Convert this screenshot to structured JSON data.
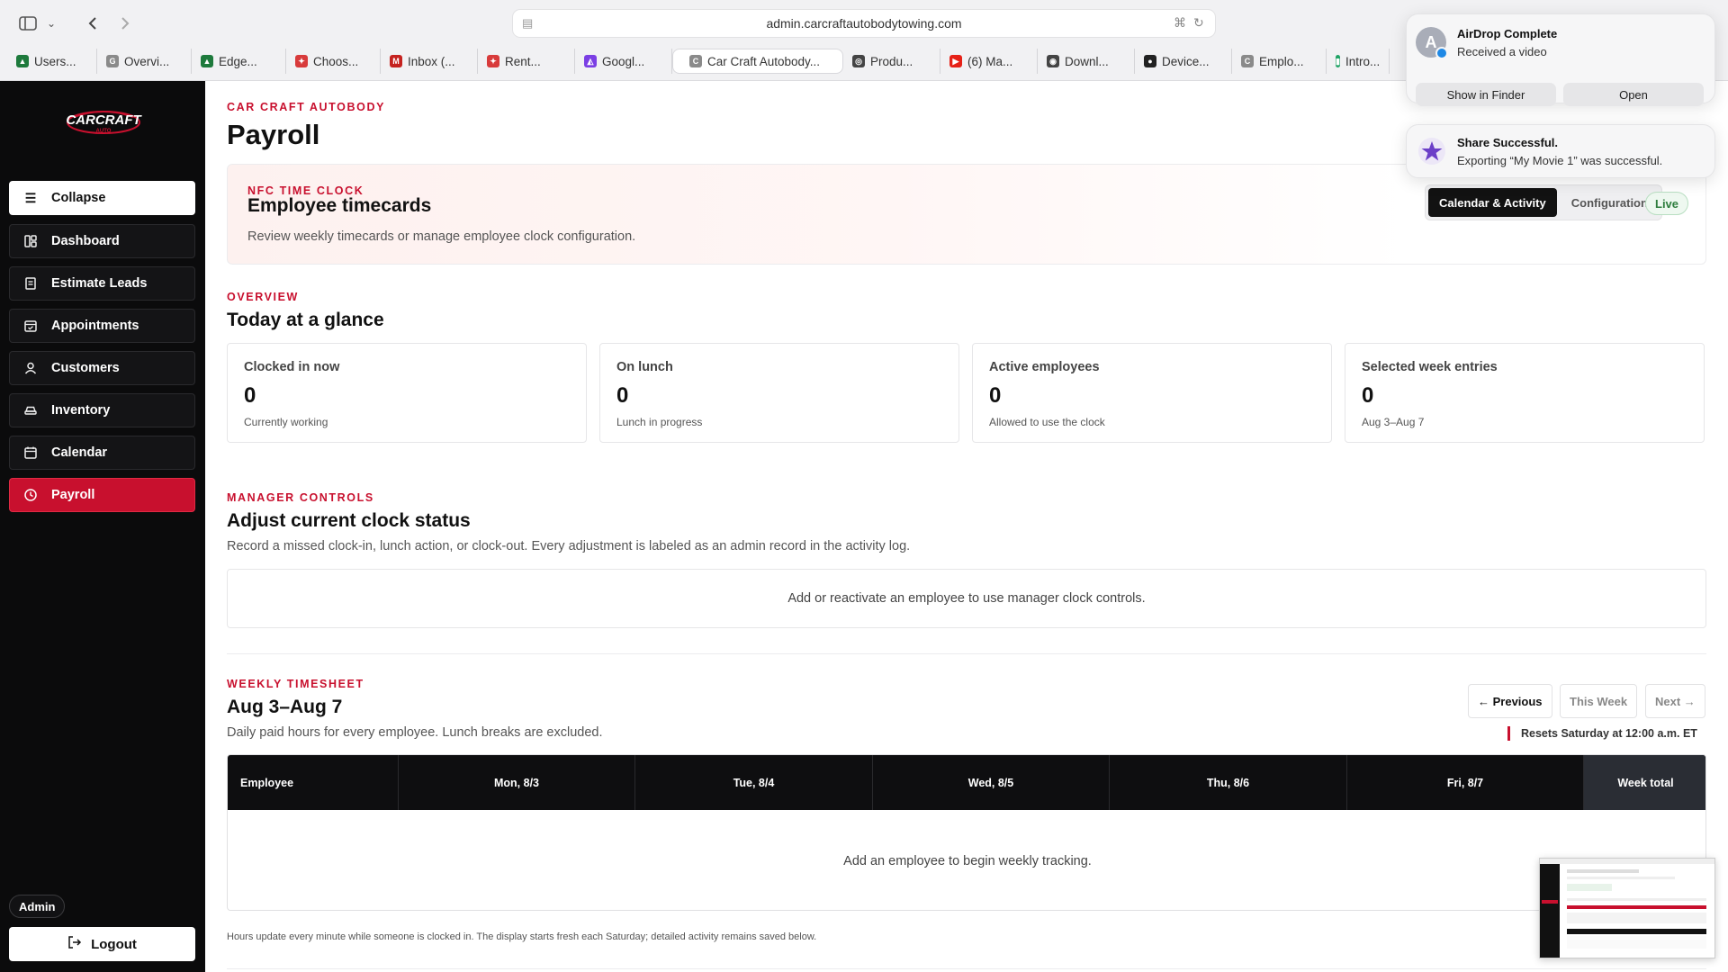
{
  "browser": {
    "url": "admin.carcraftautobodytowing.com",
    "tabs": [
      {
        "label": "Users...",
        "color": "#1e7a3c",
        "glyph": "▲"
      },
      {
        "label": "Overvi...",
        "color": "#8a8a8a",
        "glyph": "G"
      },
      {
        "label": "Edge...",
        "color": "#1e7a3c",
        "glyph": "▲"
      },
      {
        "label": "Choos...",
        "color": "#d83b3b",
        "glyph": "✦"
      },
      {
        "label": "Inbox (...",
        "color": "#c5221f",
        "glyph": "M"
      },
      {
        "label": "Rent...",
        "color": "#d83b3b",
        "glyph": "✦"
      },
      {
        "label": "Googl...",
        "color": "#7b3fe4",
        "glyph": "◭"
      },
      {
        "label": "Car Craft Autobody...",
        "color": "#8a8a8a",
        "glyph": "C"
      },
      {
        "label": "Produ...",
        "color": "#444444",
        "glyph": "◎"
      },
      {
        "label": "(6) Ma...",
        "color": "#e62117",
        "glyph": "▶"
      },
      {
        "label": "Downl...",
        "color": "#444444",
        "glyph": "◉"
      },
      {
        "label": "Device...",
        "color": "#222222",
        "glyph": "●"
      },
      {
        "label": "Emplo...",
        "color": "#8a8a8a",
        "glyph": "C"
      },
      {
        "label": "Intro...",
        "color": "#21a366",
        "glyph": "▮"
      }
    ]
  },
  "sidebar": {
    "logo_text": "CARCRAFT",
    "logo_sub": "AUTO",
    "collapse_label": "Collapse",
    "items": [
      {
        "label": "Dashboard",
        "icon": "dashboard-icon"
      },
      {
        "label": "Estimate Leads",
        "icon": "document-icon"
      },
      {
        "label": "Appointments",
        "icon": "calendar-check-icon"
      },
      {
        "label": "Customers",
        "icon": "user-icon"
      },
      {
        "label": "Inventory",
        "icon": "car-icon"
      },
      {
        "label": "Calendar",
        "icon": "calendar-icon"
      },
      {
        "label": "Payroll",
        "icon": "clock-icon"
      }
    ],
    "admin_badge": "Admin",
    "logout_label": "Logout"
  },
  "header": {
    "eyebrow": "CAR CRAFT AUTOBODY",
    "title": "Payroll"
  },
  "timecards": {
    "eyebrow": "NFC TIME CLOCK",
    "title": "Employee timecards",
    "description": "Review weekly timecards or manage employee clock configuration.",
    "tabs": [
      "Calendar & Activity",
      "Configuration"
    ],
    "active_tab": "Calendar & Activity",
    "status": "Live"
  },
  "overview": {
    "eyebrow": "OVERVIEW",
    "title": "Today at a glance",
    "stats": [
      {
        "label": "Clocked in now",
        "value": "0",
        "sub": "Currently working"
      },
      {
        "label": "On lunch",
        "value": "0",
        "sub": "Lunch in progress"
      },
      {
        "label": "Active employees",
        "value": "0",
        "sub": "Allowed to use the clock"
      },
      {
        "label": "Selected week entries",
        "value": "0",
        "sub": "Aug 3–Aug 7"
      }
    ]
  },
  "manager": {
    "eyebrow": "MANAGER CONTROLS",
    "title": "Adjust current clock status",
    "description": "Record a missed clock-in, lunch action, or clock-out. Every adjustment is labeled as an admin record in the activity log.",
    "empty": "Add or reactivate an employee to use manager clock controls."
  },
  "weekly": {
    "eyebrow": "WEEKLY TIMESHEET",
    "title": "Aug 3–Aug 7",
    "description": "Daily paid hours for every employee. Lunch breaks are excluded.",
    "prev_label": "← Previous",
    "this_week_label": "This Week",
    "next_label": "Next →",
    "resets": "Resets Saturday at 12:00 a.m. ET",
    "columns": [
      "Employee",
      "Mon, 8/3",
      "Tue, 8/4",
      "Wed, 8/5",
      "Thu, 8/6",
      "Fri, 8/7",
      "Week total"
    ],
    "empty": "Add an employee to begin weekly tracking.",
    "footnote": "Hours update every minute while someone is clocked in. The display starts fresh each Saturday; detailed activity remains saved below."
  },
  "notifications": {
    "airdrop": {
      "title": "AirDrop Complete",
      "body": "Received a video",
      "avatar": "A",
      "show_label": "Show in Finder",
      "open_label": "Open"
    },
    "share": {
      "title": "Share Successful.",
      "body": "Exporting “My Movie 1” was successful."
    }
  },
  "colors": {
    "brand_red": "#c8102e",
    "sidebar_bg": "#0b0b0c",
    "live_green": "#2e7d3e"
  }
}
